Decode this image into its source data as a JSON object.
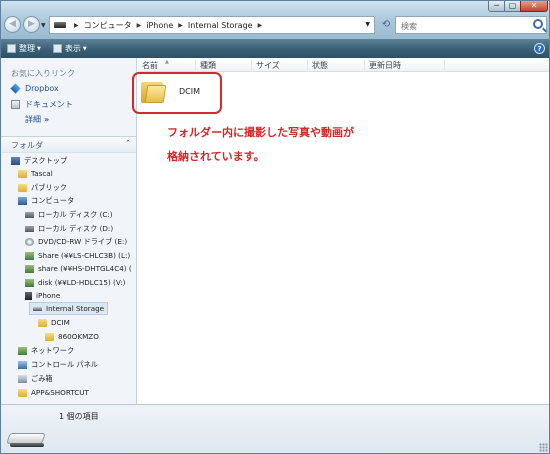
{
  "window": {
    "controls": {
      "minimize": "─",
      "maximize": "▢",
      "close": "✕"
    }
  },
  "address": {
    "segments": [
      "コンピュータ",
      "iPhone",
      "Internal Storage"
    ]
  },
  "search": {
    "placeholder": "検索"
  },
  "toolbar": {
    "organize_label": "整理",
    "views_label": "表示",
    "help_label": "?"
  },
  "favorites": {
    "title": "お気に入りリンク",
    "items": [
      "Dropbox",
      "ドキュメント"
    ],
    "more_label": "詳細",
    "more_chevron": "»"
  },
  "folders_pane": {
    "title": "フォルダ",
    "collapse_icon": "chevron-up-icon",
    "tree": [
      {
        "label": "デスクトップ",
        "icon": "desktop-icon"
      },
      {
        "label": "Tascal",
        "icon": "folder-icon"
      },
      {
        "label": "パブリック",
        "icon": "folder-icon"
      },
      {
        "label": "コンピュータ",
        "icon": "computer-icon"
      },
      {
        "label": "ローカル ディスク (C:)",
        "icon": "hard-disk-icon"
      },
      {
        "label": "ローカル ディスク (D:)",
        "icon": "hard-disk-icon"
      },
      {
        "label": "DVD/CD-RW ドライブ (E:)",
        "icon": "dvd-drive-icon"
      },
      {
        "label": "Share (¥¥LS-CHLC3B) (L:)",
        "icon": "network-drive-icon"
      },
      {
        "label": "share (¥¥HS-DHTGL4C4) (",
        "icon": "network-drive-icon"
      },
      {
        "label": "disk (¥¥LD-HDLC15) (V:)",
        "icon": "network-drive-icon"
      },
      {
        "label": "iPhone",
        "icon": "iphone-icon"
      },
      {
        "label": "Internal Storage",
        "icon": "storage-icon",
        "selected": true
      },
      {
        "label": "DCIM",
        "icon": "folder-icon"
      },
      {
        "label": "860OKMZO",
        "icon": "folder-icon"
      },
      {
        "label": "ネットワーク",
        "icon": "network-icon"
      },
      {
        "label": "コントロール パネル",
        "icon": "control-panel-icon"
      },
      {
        "label": "ごみ箱",
        "icon": "recycle-bin-icon"
      },
      {
        "label": "APP&SHORTCUT",
        "icon": "folder-icon"
      }
    ]
  },
  "columns": [
    "名前",
    "種類",
    "サイズ",
    "状態",
    "更新日時"
  ],
  "files": [
    {
      "name": "DCIM",
      "icon": "folder-icon"
    }
  ],
  "annotation": {
    "line1": "フォルダー内に撮影した写真や動画が",
    "line2": "格納されています。",
    "color": "#d22828"
  },
  "details": {
    "item_count": "1 個の項目"
  }
}
